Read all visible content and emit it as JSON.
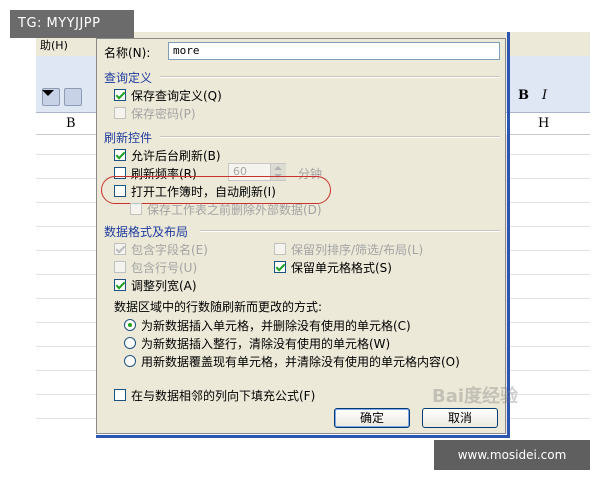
{
  "watermark_top": "TG: MYYJJPP",
  "watermark_bottom": "www.mosidei.com",
  "watermark_faint": "Bai度经验",
  "excel": {
    "menu_fragment": "助(H)",
    "bold_label": "B",
    "italic_label": "I",
    "col_b": "B",
    "col_h": "H"
  },
  "dialog": {
    "name_label": "名称(N):",
    "name_value": "more",
    "query_section": "查询定义",
    "save_query_def": "保存查询定义(Q)",
    "save_password": "保存密码(P)",
    "refresh_section": "刷新控件",
    "allow_bg_refresh": "允许后台刷新(B)",
    "refresh_freq": "刷新频率(R)",
    "refresh_freq_value": "60",
    "minutes": "分钟",
    "refresh_on_open": "打开工作簿时，自动刷新(I)",
    "remove_external": "保存工作表之前删除外部数据(D)",
    "format_section": "数据格式及布局",
    "include_field_names": "包含字段名(E)",
    "include_row_numbers": "包含行号(U)",
    "adjust_col_width": "调整列宽(A)",
    "preserve_sort": "保留列排序/筛选/布局(L)",
    "preserve_cell_format": "保留单元格格式(S)",
    "change_method_label": "数据区域中的行数随刷新而更改的方式:",
    "radio_insert_cells": "为新数据插入单元格，并删除没有使用的单元格(C)",
    "radio_insert_rows": "为新数据插入整行，清除没有使用的单元格(W)",
    "radio_overwrite": "用新数据覆盖现有单元格，并清除没有使用的单元格内容(O)",
    "fill_formulas": "在与数据相邻的列向下填充公式(F)",
    "ok_label": "确定",
    "cancel_label": "取消"
  }
}
